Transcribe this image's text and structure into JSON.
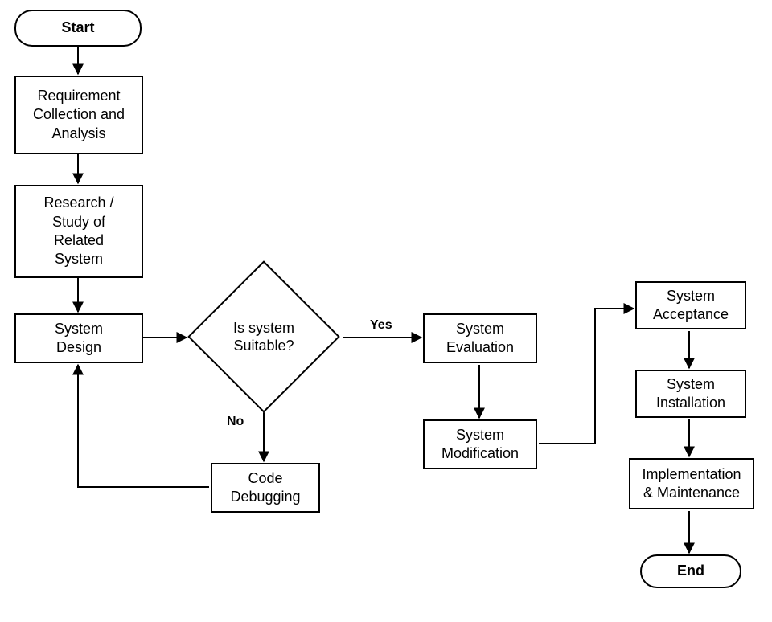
{
  "flowchart": {
    "nodes": {
      "start": {
        "label": "Start"
      },
      "requirements": {
        "label": "Requirement\nCollection and\nAnalysis"
      },
      "research": {
        "label": "Research /\nStudy of\nRelated\nSystem"
      },
      "design": {
        "label": "System\nDesign"
      },
      "decision": {
        "label": "Is system\nSuitable?"
      },
      "evaluation": {
        "label": "System\nEvaluation"
      },
      "modification": {
        "label": "System\nModification"
      },
      "code_debugging": {
        "label": "Code\nDebugging"
      },
      "acceptance": {
        "label": "System\nAcceptance"
      },
      "installation": {
        "label": "System\nInstallation"
      },
      "impl_maint": {
        "label": "Implementation\n& Maintenance"
      },
      "end": {
        "label": "End"
      }
    },
    "edges": {
      "yes": "Yes",
      "no": "No"
    }
  }
}
